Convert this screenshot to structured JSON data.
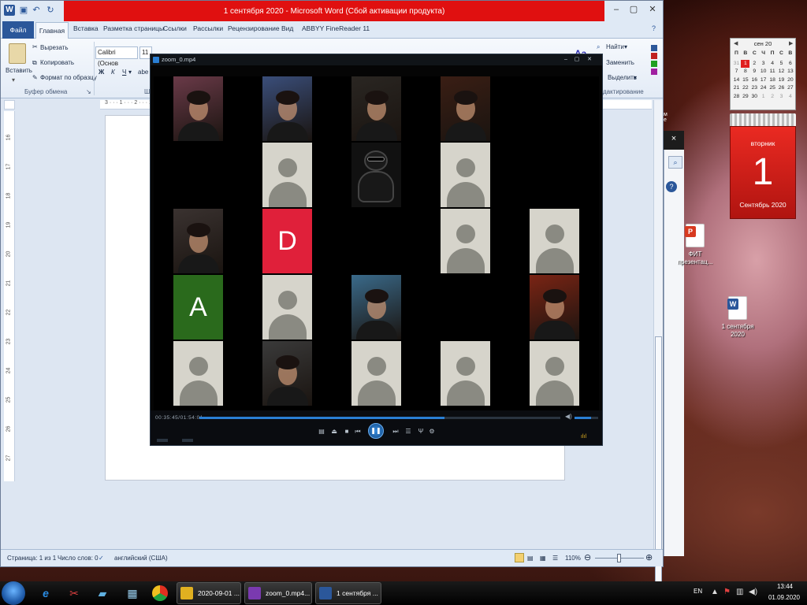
{
  "word": {
    "title": "1 сентября 2020 - Microsoft Word (Сбой активации продукта)",
    "tabs": [
      "Главная",
      "Вставка",
      "Разметка страницы",
      "Ссылки",
      "Рассылки",
      "Рецензирование",
      "Вид",
      "ABBYY FineReader 11"
    ],
    "file_tab": "Файл",
    "clipboard": {
      "paste": "Вставить",
      "cut": "Вырезать",
      "copy": "Копировать",
      "format_painter": "Формат по образцу",
      "group_label": "Буфер обмена"
    },
    "font_name": "Calibri (Основ",
    "font_size": "11",
    "editing": {
      "find": "Найти",
      "replace": "Заменить",
      "select": "Выделить",
      "group_label": "Редактирование",
      "group_label_visible": "дактирование"
    },
    "font_group_label_visible": "Ш",
    "ruler_h_text": "3 · · · 1 · · · 2 · · · 1 · · ·",
    "ruler_v_ticks": [
      "16",
      "17",
      "18",
      "19",
      "20",
      "21",
      "22",
      "23",
      "24",
      "25",
      "26",
      "27"
    ],
    "status": {
      "page": "Страница: 1 из 1",
      "words": "Число слов: 0",
      "language": "английский (США)",
      "zoom": "110%"
    }
  },
  "player": {
    "title": "zoom_0.mp4",
    "time": "00:35:45/01:54:01",
    "progress_fraction": 0.68,
    "volume_fraction": 0.7,
    "tiles": [
      {
        "kind": "video",
        "col": 0,
        "row": 0,
        "tone": "#6a3a48"
      },
      {
        "kind": "video",
        "col": 1,
        "row": 0,
        "tone": "#3a4e7a"
      },
      {
        "kind": "video",
        "col": 2,
        "row": 0,
        "tone": "#2a2622"
      },
      {
        "kind": "video",
        "col": 3,
        "row": 0,
        "tone": "#3a1e14"
      },
      {
        "kind": "avatar",
        "col": 1,
        "row": 1
      },
      {
        "kind": "cartoon",
        "col": 2,
        "row": 1
      },
      {
        "kind": "avatar",
        "col": 3,
        "row": 1
      },
      {
        "kind": "video",
        "col": 0,
        "row": 2,
        "tone": "#3a3230"
      },
      {
        "kind": "letter",
        "col": 1,
        "row": 2,
        "letter": "D",
        "color": "#e0203a"
      },
      {
        "kind": "avatar",
        "col": 3,
        "row": 2
      },
      {
        "kind": "avatar",
        "col": 4,
        "row": 2
      },
      {
        "kind": "letter",
        "col": 0,
        "row": 3,
        "letter": "A",
        "color": "#2a6a1c"
      },
      {
        "kind": "avatar",
        "col": 1,
        "row": 3
      },
      {
        "kind": "video",
        "col": 2,
        "row": 3,
        "tone": "#3a6a8a"
      },
      {
        "kind": "video",
        "col": 4,
        "row": 3,
        "tone": "#7a2414"
      },
      {
        "kind": "avatar",
        "col": 0,
        "row": 4
      },
      {
        "kind": "video",
        "col": 1,
        "row": 4,
        "tone": "#3a3a3a"
      },
      {
        "kind": "avatar",
        "col": 2,
        "row": 4
      },
      {
        "kind": "avatar",
        "col": 3,
        "row": 4
      },
      {
        "kind": "avatar",
        "col": 4,
        "row": 4
      }
    ]
  },
  "calendar": {
    "month_header": "сен 20",
    "weekday_headers": [
      "П",
      "В",
      "С",
      "Ч",
      "П",
      "С",
      "В"
    ],
    "days": [
      [
        "31",
        "1",
        "2",
        "3",
        "4",
        "5",
        "6"
      ],
      [
        "7",
        "8",
        "9",
        "10",
        "11",
        "12",
        "13"
      ],
      [
        "14",
        "15",
        "16",
        "17",
        "18",
        "19",
        "20"
      ],
      [
        "21",
        "22",
        "23",
        "24",
        "25",
        "26",
        "27"
      ],
      [
        "28",
        "29",
        "30",
        "1",
        "2",
        "3",
        "4"
      ]
    ],
    "weekday": "вторник",
    "day": "1",
    "month_year": "Сентябрь 2020"
  },
  "desktop_icons": [
    {
      "label": "ФИТ презентац...",
      "color": "#d83a20"
    },
    {
      "label": "1 сентября 2020",
      "color": "#2b579a"
    }
  ],
  "taskbar": {
    "tasks": [
      {
        "label": "2020-09-01 ...",
        "color": "#e0b020"
      },
      {
        "label": "zoom_0.mp4...",
        "color": "#7a3ab0"
      },
      {
        "label": "1 сентября ...",
        "color": "#2b579a"
      }
    ],
    "lang": "EN",
    "time": "13:44",
    "date": "01.09.2020"
  },
  "colors": {
    "word_accent": "#2b579a",
    "title_alert": "#e01010",
    "player_accent": "#2a7fd4",
    "calendar_red": "#e02020"
  }
}
